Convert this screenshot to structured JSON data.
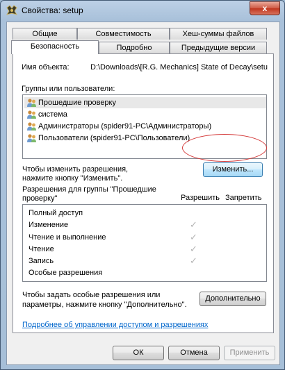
{
  "window": {
    "title": "Свойства: setup",
    "close_glyph": "x",
    "icon": "app-icon"
  },
  "tabs": {
    "row1": [
      "Общие",
      "Совместимость",
      "Хеш-суммы файлов"
    ],
    "row2": [
      "Безопасность",
      "Подробно",
      "Предыдущие версии"
    ],
    "active": "Безопасность"
  },
  "security": {
    "object_label": "Имя объекта:",
    "object_value": "D:\\Downloads\\[R.G. Mechanics] State of Decay\\setu",
    "groups_label": "Группы или пользователи:",
    "groups": [
      {
        "name": "Прошедшие проверку",
        "selected": true
      },
      {
        "name": "система",
        "selected": false
      },
      {
        "name": "Администраторы (spider91-PC\\Администраторы)",
        "selected": false
      },
      {
        "name": "Пользователи (spider91-PC\\Пользователи)",
        "selected": false
      }
    ],
    "change_hint_1": "Чтобы изменить разрешения,",
    "change_hint_2": "нажмите кнопку \"Изменить\".",
    "change_button": "Изменить...",
    "perm_label_1": "Разрешения для группы \"Прошедшие",
    "perm_label_2": "проверку\"",
    "col_allow": "Разрешить",
    "col_deny": "Запретить",
    "permissions": [
      {
        "name": "Полный доступ",
        "allow": false
      },
      {
        "name": "Изменение",
        "allow": true
      },
      {
        "name": "Чтение и выполнение",
        "allow": true
      },
      {
        "name": "Чтение",
        "allow": true
      },
      {
        "name": "Запись",
        "allow": true
      },
      {
        "name": "Особые разрешения",
        "allow": false
      }
    ],
    "advanced_hint_1": "Чтобы задать особые разрешения или",
    "advanced_hint_2": "параметры, нажмите кнопку \"Дополнительно\".",
    "advanced_button": "Дополнительно",
    "link": "Подробнее об управлении доступом и разрешениях"
  },
  "footer": {
    "ok": "ОК",
    "cancel": "Отмена",
    "apply": "Применить"
  }
}
